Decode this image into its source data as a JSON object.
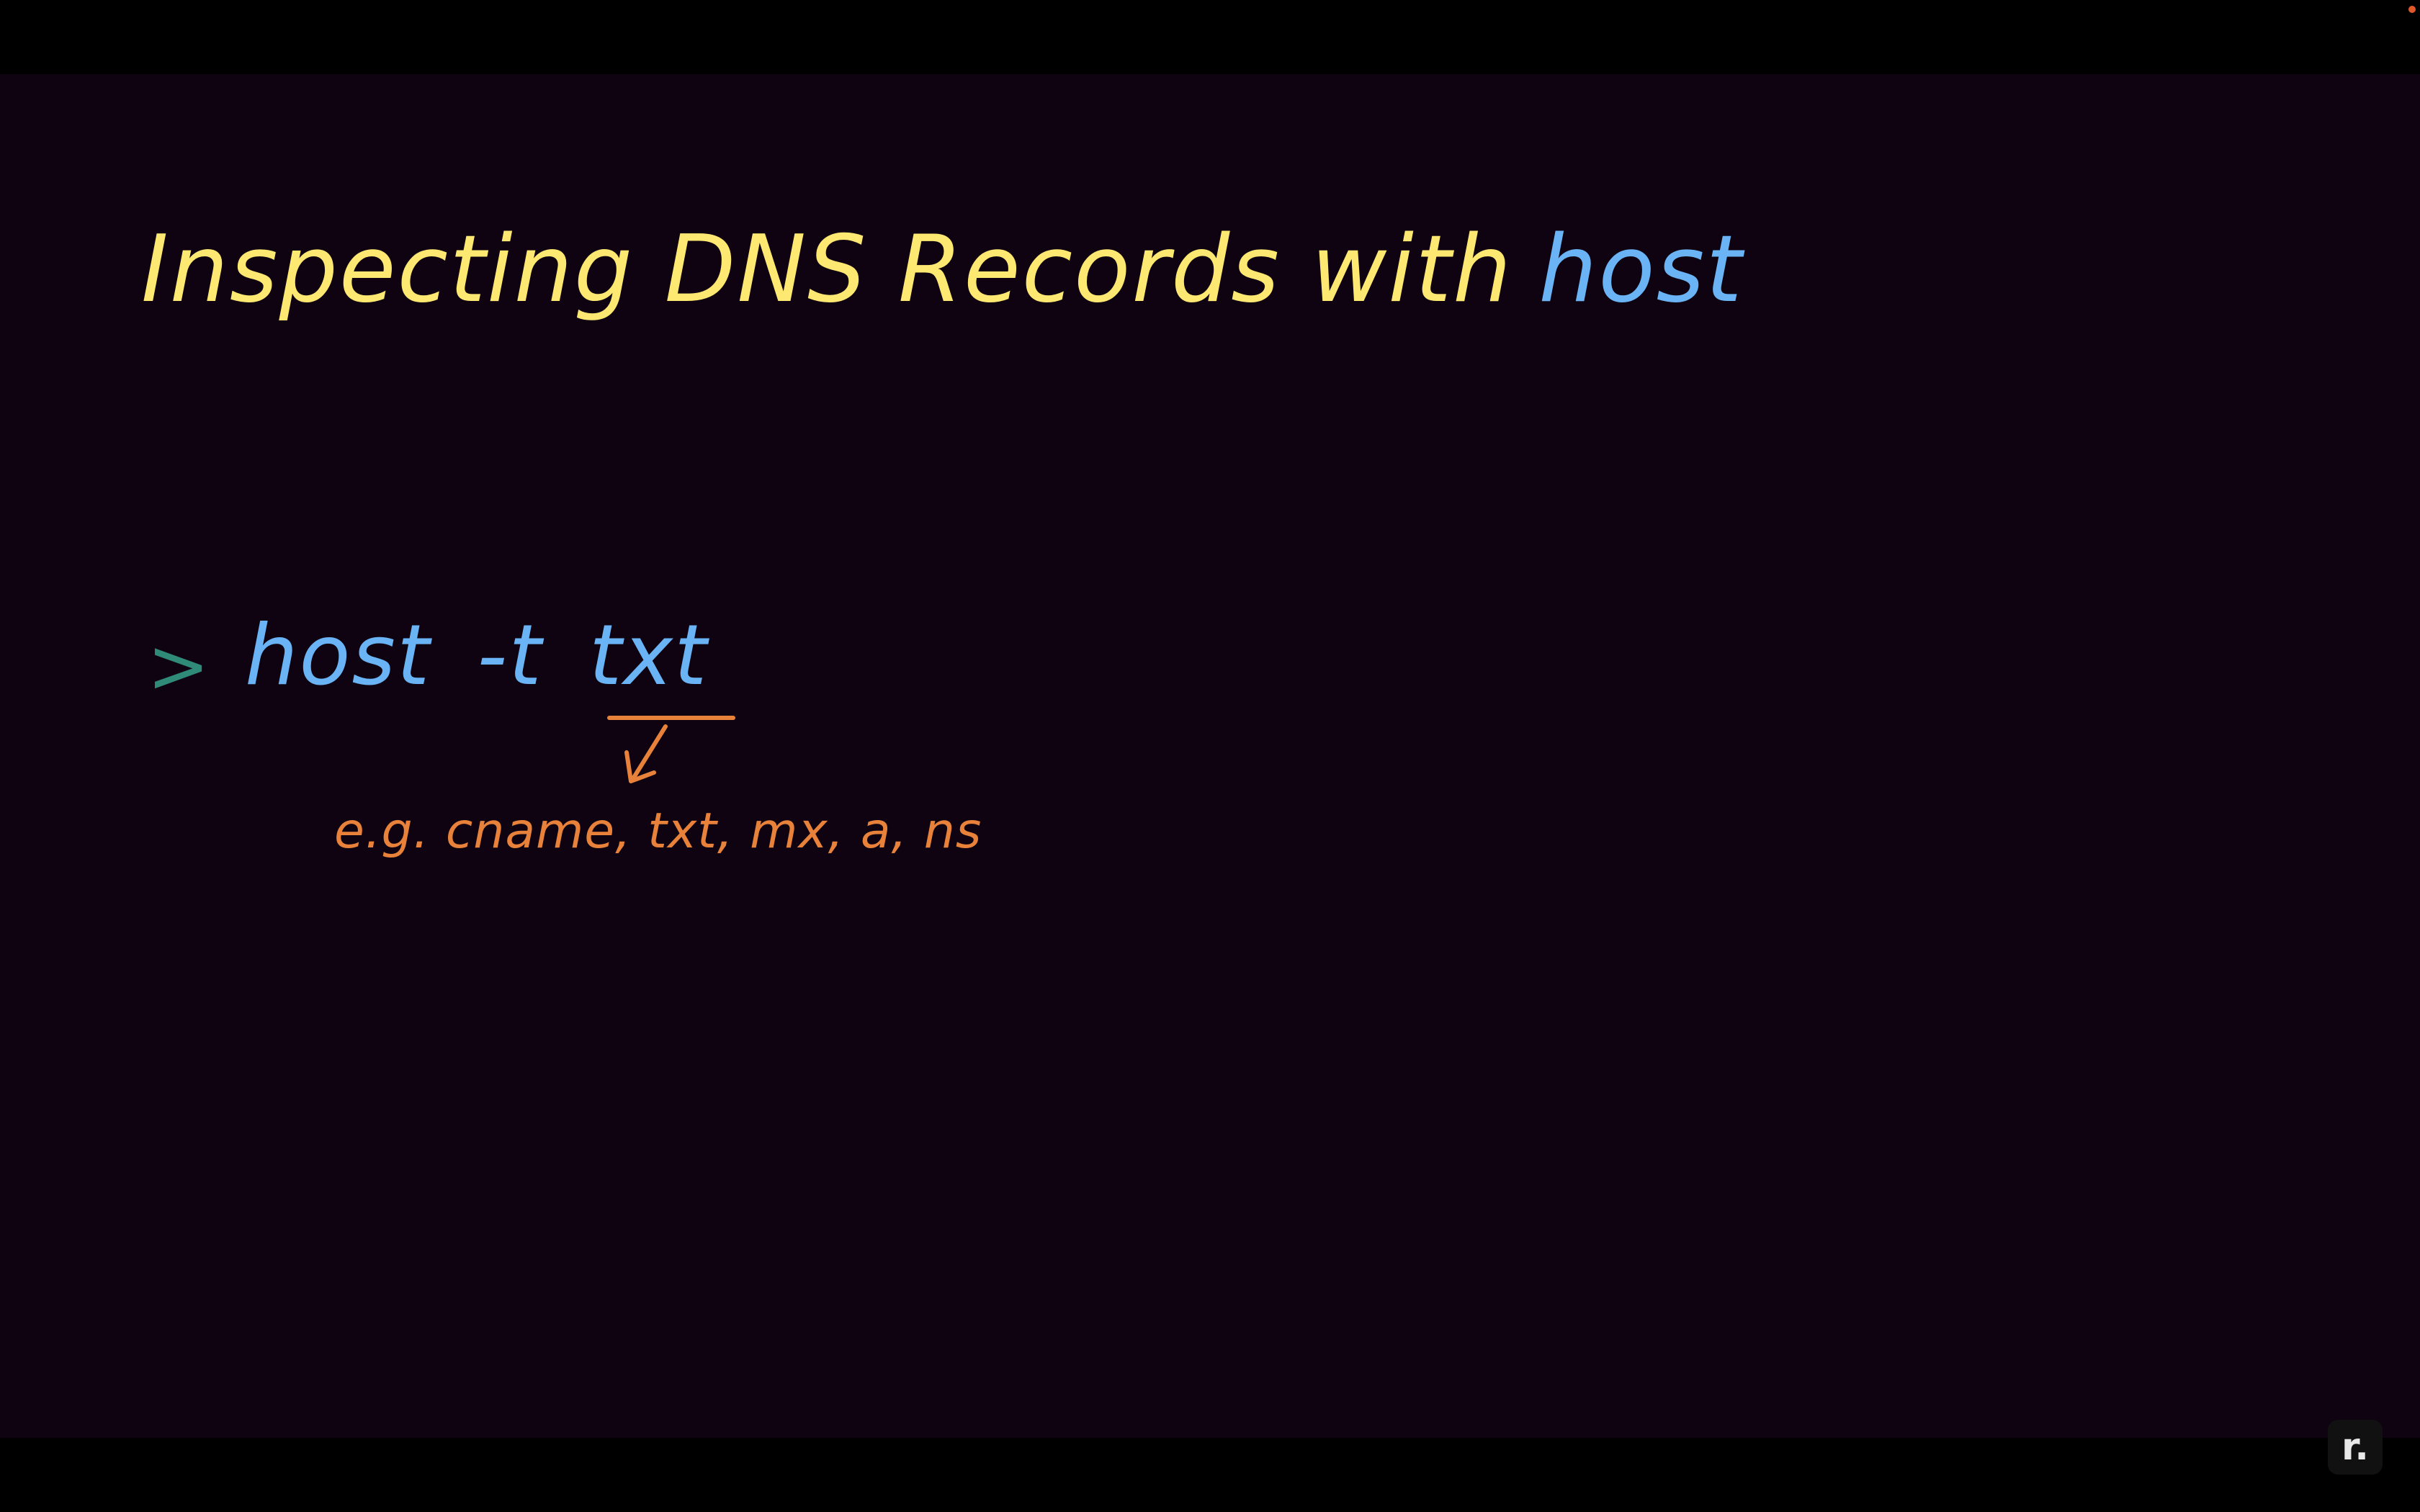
{
  "slide": {
    "title": {
      "text": "Inspecting DNS Records with",
      "highlight": "host"
    },
    "command": {
      "prompt_symbol": ">",
      "tokens": [
        "host",
        "-t",
        "txt"
      ]
    },
    "annotation": "e.g. cname, txt, mx, a, ns"
  },
  "watermark": {
    "logo_glyph": "r."
  },
  "colors": {
    "background": "#0f0311",
    "title": "#fde872",
    "command": "#6ab4f5",
    "prompt": "#2f8a78",
    "annotation": "#e8823a"
  },
  "icons": {
    "arrow": "down-left-arrow-icon",
    "logo": "recorder-logo-icon",
    "recording": "recording-dot-icon"
  }
}
